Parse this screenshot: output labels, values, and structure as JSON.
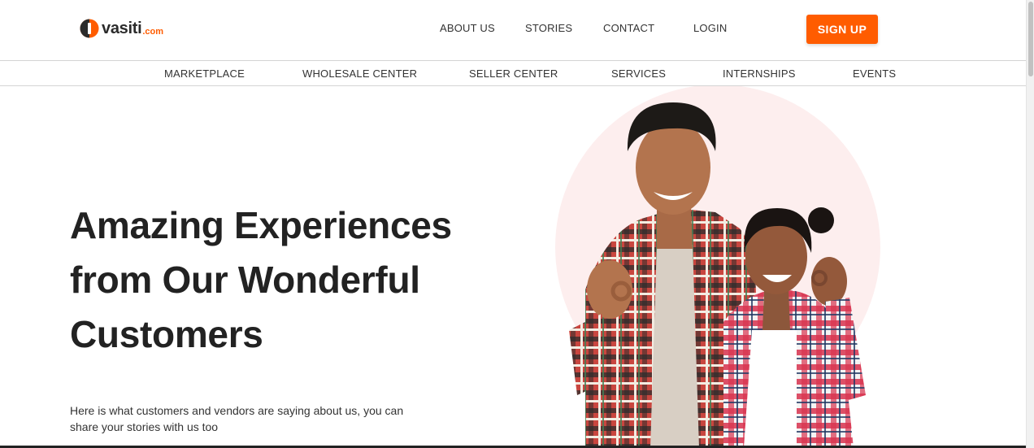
{
  "brand": {
    "name": "vasiti",
    "tld": ".com",
    "accent_color": "#ff5c00"
  },
  "top_nav": {
    "items": [
      {
        "label": "ABOUT US"
      },
      {
        "label": "STORIES"
      },
      {
        "label": "CONTACT"
      },
      {
        "label": "LOGIN"
      }
    ],
    "signup_label": "SIGN UP"
  },
  "sub_nav": {
    "items": [
      {
        "label": "MARKETPLACE"
      },
      {
        "label": "WHOLESALE CENTER"
      },
      {
        "label": "SELLER CENTER"
      },
      {
        "label": "SERVICES"
      },
      {
        "label": "INTERNSHIPS"
      },
      {
        "label": "EVENTS"
      }
    ]
  },
  "hero": {
    "title_lines": [
      "Amazing Experiences",
      "from Our Wonderful",
      "Customers"
    ],
    "subtitle": "Here is what customers and vendors are saying about us, you can share your stories with us too",
    "circle_color": "#fdeeee"
  }
}
